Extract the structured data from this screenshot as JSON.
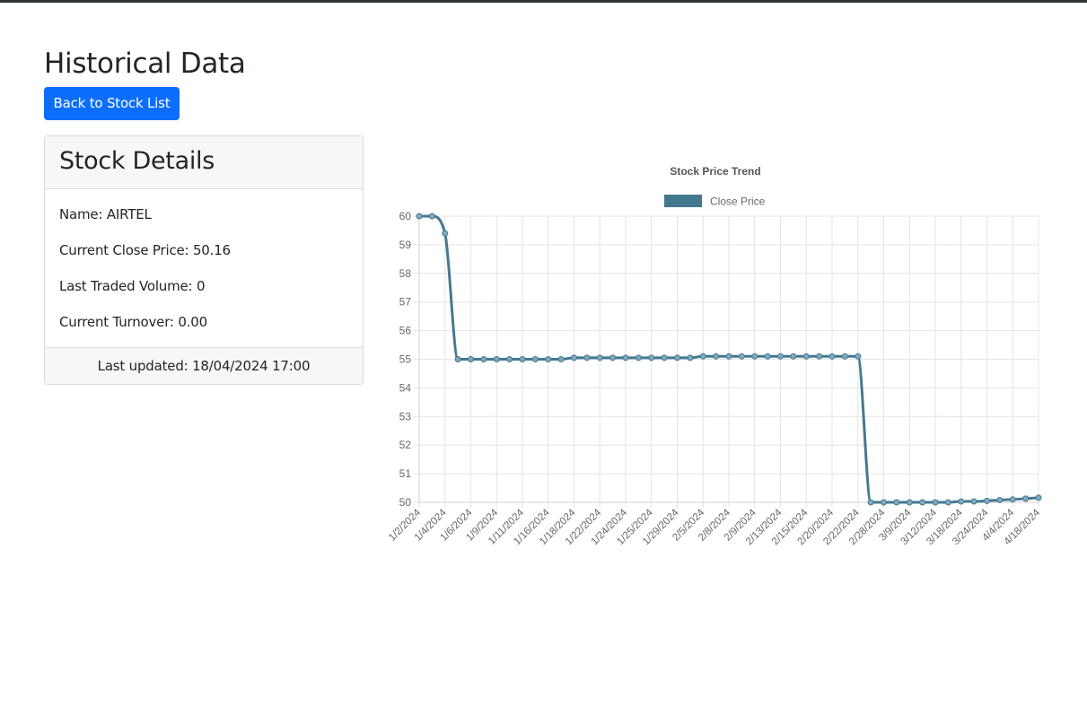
{
  "page": {
    "title": "Historical Data",
    "back_button": "Back to Stock List"
  },
  "card": {
    "header": "Stock Details",
    "name": "Name: AIRTEL",
    "close_price": "Current Close Price: 50.16",
    "volume": "Last Traded Volume: 0",
    "turnover": "Current Turnover: 0.00",
    "footer": "Last updated: 18/04/2024 17:00"
  },
  "colors": {
    "line": "#44788f",
    "point_fill": "#7fa9c2",
    "legend_box": "#44788f",
    "button": "#0d6efd"
  },
  "chart_data": {
    "type": "line",
    "title": "Stock Price Trend",
    "series": [
      {
        "name": "Close Price",
        "values": [
          60,
          60,
          59.4,
          55,
          55,
          55,
          55,
          55,
          55,
          55,
          55,
          55,
          55.05,
          55.05,
          55.05,
          55.05,
          55.05,
          55.05,
          55.05,
          55.05,
          55.05,
          55.05,
          55.1,
          55.1,
          55.1,
          55.1,
          55.1,
          55.1,
          55.1,
          55.1,
          55.1,
          55.1,
          55.1,
          55.1,
          55.1,
          50,
          50,
          50,
          50,
          50,
          50,
          50,
          50.03,
          50.03,
          50.05,
          50.08,
          50.1,
          50.13,
          50.16
        ]
      }
    ],
    "x_tick_labels": [
      "1/2/2024",
      "1/4/2024",
      "1/6/2024",
      "1/9/2024",
      "1/11/2024",
      "1/16/2024",
      "1/18/2024",
      "1/22/2024",
      "1/24/2024",
      "1/25/2024",
      "1/29/2024",
      "2/5/2024",
      "2/8/2024",
      "2/9/2024",
      "2/13/2024",
      "2/15/2024",
      "2/20/2024",
      "2/22/2024",
      "2/28/2024",
      "3/9/2024",
      "3/12/2024",
      "3/18/2024",
      "3/24/2024",
      "4/4/2024",
      "4/18/2024"
    ],
    "ylim": [
      50,
      60
    ],
    "y_ticks": [
      60,
      59,
      58,
      57,
      56,
      55,
      54,
      53,
      52,
      51,
      50
    ],
    "grid": true,
    "legend_position": "top",
    "xlabel": "",
    "ylabel": ""
  }
}
